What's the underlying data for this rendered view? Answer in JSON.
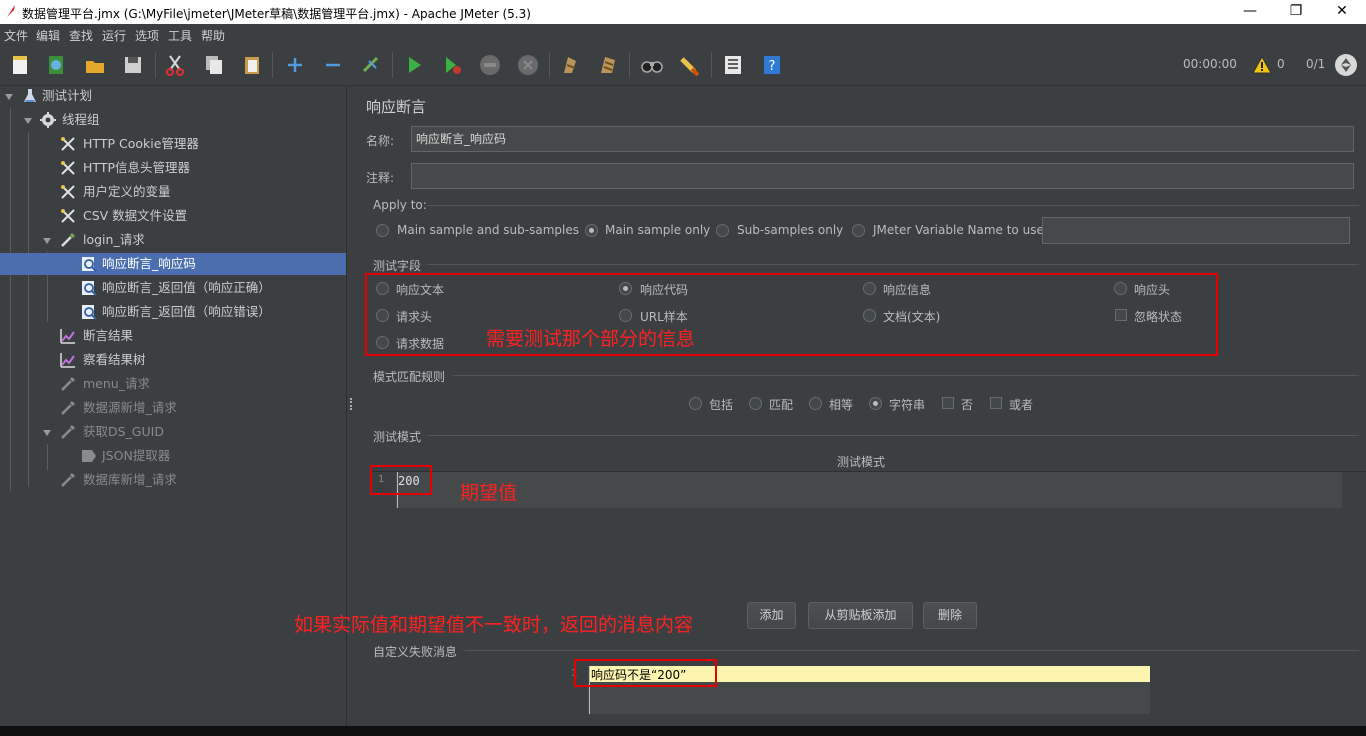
{
  "window": {
    "title": "数据管理平台.jmx (G:\\MyFile\\jmeter\\JMeter草稿\\数据管理平台.jmx) - Apache JMeter (5.3)",
    "minimize": "—",
    "maximize": "❐",
    "close": "✕"
  },
  "menu": [
    "文件",
    "编辑",
    "查找",
    "运行",
    "选项",
    "工具",
    "帮助"
  ],
  "toolbar": {
    "timer": "00:00:00",
    "warnings": "0",
    "threads": "0/1"
  },
  "tree": {
    "items": [
      {
        "label": "测试计划",
        "icon": "flask-icon"
      },
      {
        "label": "线程组",
        "icon": "gear-icon"
      },
      {
        "label": "HTTP Cookie管理器",
        "icon": "tools-icon"
      },
      {
        "label": "HTTP信息头管理器",
        "icon": "tools-icon"
      },
      {
        "label": "用户定义的变量",
        "icon": "tools-icon"
      },
      {
        "label": "CSV 数据文件设置",
        "icon": "tools-icon"
      },
      {
        "label": "login_请求",
        "icon": "pipette-icon"
      },
      {
        "label": "响应断言_响应码",
        "icon": "assertion-icon"
      },
      {
        "label": "响应断言_返回值（响应正确）",
        "icon": "assertion-icon"
      },
      {
        "label": "响应断言_返回值（响应错误）",
        "icon": "assertion-icon"
      },
      {
        "label": "断言结果",
        "icon": "chart-icon"
      },
      {
        "label": "察看结果树",
        "icon": "chart-icon"
      },
      {
        "label": "menu_请求",
        "icon": "pipette-icon"
      },
      {
        "label": "数据源新增_请求",
        "icon": "pipette-icon"
      },
      {
        "label": "获取DS_GUID",
        "icon": "pipette-icon"
      },
      {
        "label": "JSON提取器",
        "icon": "extractor-icon"
      },
      {
        "label": "数据库新增_请求",
        "icon": "pipette-icon"
      }
    ]
  },
  "panel": {
    "title": "响应断言",
    "name_label": "名称:",
    "name_value": "响应断言_响应码",
    "comment_label": "注释:",
    "comment_value": "",
    "apply_to": {
      "label": "Apply to:",
      "options": [
        "Main sample and sub-samples",
        "Main sample only",
        "Sub-samples only",
        "JMeter Variable Name to use"
      ],
      "selected": "Main sample only",
      "variable_value": ""
    },
    "test_field": {
      "label": "测试字段",
      "options": [
        "响应文本",
        "响应代码",
        "响应信息",
        "响应头",
        "请求头",
        "URL样本",
        "文档(文本)",
        "忽略状态",
        "请求数据"
      ],
      "selected": "响应代码"
    },
    "pattern_rules": {
      "label": "模式匹配规则",
      "options": [
        "包括",
        "匹配",
        "相等",
        "字符串",
        "否",
        "或者"
      ],
      "selected": "字符串"
    },
    "test_patterns": {
      "label": "测试模式",
      "column_header": "测试模式",
      "line_no": "1",
      "value": "200"
    },
    "buttons": {
      "add": "添加",
      "add_clipboard": "从剪贴板添加",
      "delete": "删除"
    },
    "failure_message": {
      "label": "自定义失败消息",
      "line_no": "1",
      "value": "响应码不是“200”"
    }
  },
  "annotations": {
    "test_field_note": "需要测试那个部分的信息",
    "expected_note": "期望值",
    "failure_note": "如果实际值和期望值不一致时，返回的消息内容"
  },
  "colors": {
    "background": "#3c3f41",
    "selection": "#4b6eaf",
    "annotation": "#e60000",
    "message_highlight": "#fcf5b0"
  }
}
